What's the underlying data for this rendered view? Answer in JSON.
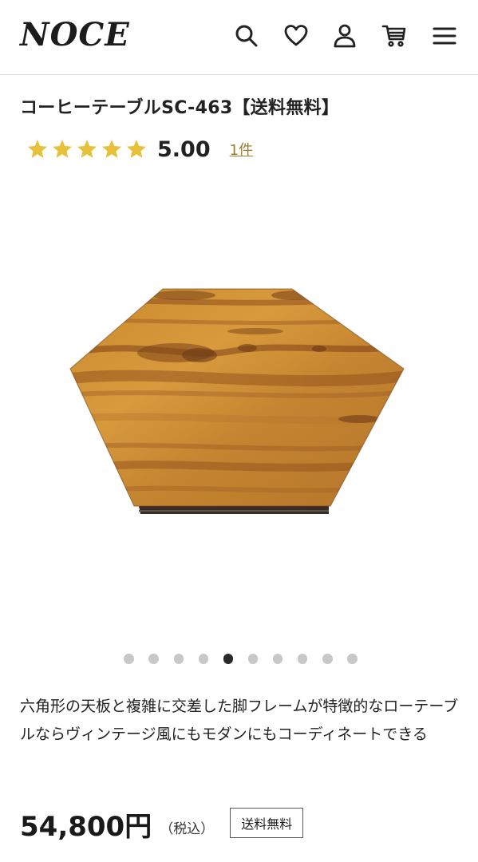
{
  "header": {
    "logo": "NOCE",
    "icons": [
      "search-icon",
      "heart-icon",
      "user-icon",
      "cart-icon",
      "menu-icon"
    ]
  },
  "product": {
    "title": "コーヒーテーブルSC-463【送料無料】",
    "rating": {
      "stars": 5,
      "score": "5.00",
      "review_count": "1件",
      "star_color": "#e8c13a"
    },
    "carousel": {
      "total": 10,
      "active_index": 4
    },
    "description": "六角形の天板と複雑に交差した脚フレームが特徴的なローテーブルならヴィンテージ風にもモダンにもコーディネートできる",
    "price": "54,800円",
    "tax_note": "（税込）",
    "shipping_badge": "送料無料"
  },
  "colors": {
    "accent_link": "#9a7d2e",
    "active_dot": "#2a2a2a",
    "inactive_dot": "#c8c8c8"
  }
}
